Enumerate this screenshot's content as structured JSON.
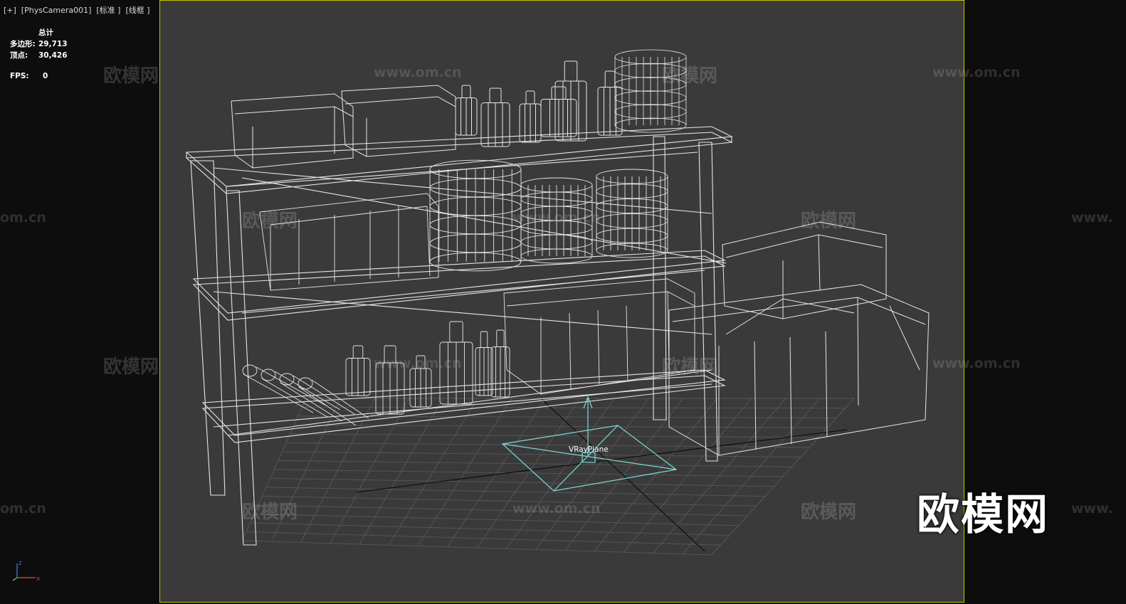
{
  "viewport": {
    "label": "[+]  [PhysCamera001]  [标准 ]  [线框 ]",
    "frame_color": "#c8c200",
    "background": "#3a3a3a"
  },
  "stats": {
    "header": "总计",
    "polygons_label": "多边形:",
    "polygons_value": "29,713",
    "vertices_label": "顶点:",
    "vertices_value": "30,426",
    "fps_label": "FPS:",
    "fps_value": "0"
  },
  "scene": {
    "object_label": "VRayPlane",
    "wire_color": "#e8e8e8",
    "light_color": "#7fd8d8"
  },
  "watermarks": {
    "logo_text": "欧模网",
    "url_text": "www.om.cn",
    "url_fragment": "om.cn",
    "url_fragment_right": "www.",
    "big_logo": "欧模网"
  },
  "axis": {
    "x": "x",
    "z": "z"
  }
}
